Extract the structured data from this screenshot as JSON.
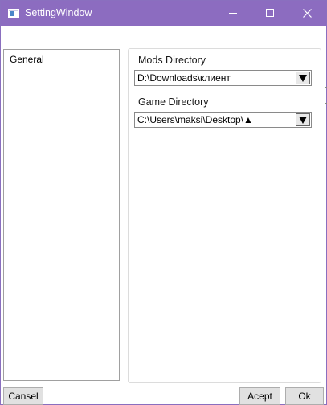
{
  "window": {
    "title": "SettingWindow"
  },
  "sidebar": {
    "items": [
      {
        "label": "General"
      }
    ]
  },
  "settings": {
    "mods_directory": {
      "label": "Mods Directory",
      "value": "D:\\Downloads\\клиент"
    },
    "game_directory": {
      "label": "Game Directory",
      "value": "C:\\Users\\maksi\\Desktop\\▲"
    }
  },
  "footer": {
    "cansel_label": "Cansel",
    "acept_label": "Acept",
    "ok_label": "Ok"
  },
  "colors": {
    "titlebar": "#8c6cc0",
    "button_face": "#e1e1e1",
    "border": "#a0a0a0"
  },
  "icons": [
    "window-icon",
    "minimize-icon",
    "maximize-icon",
    "close-icon",
    "dropdown-arrow-icon"
  ]
}
